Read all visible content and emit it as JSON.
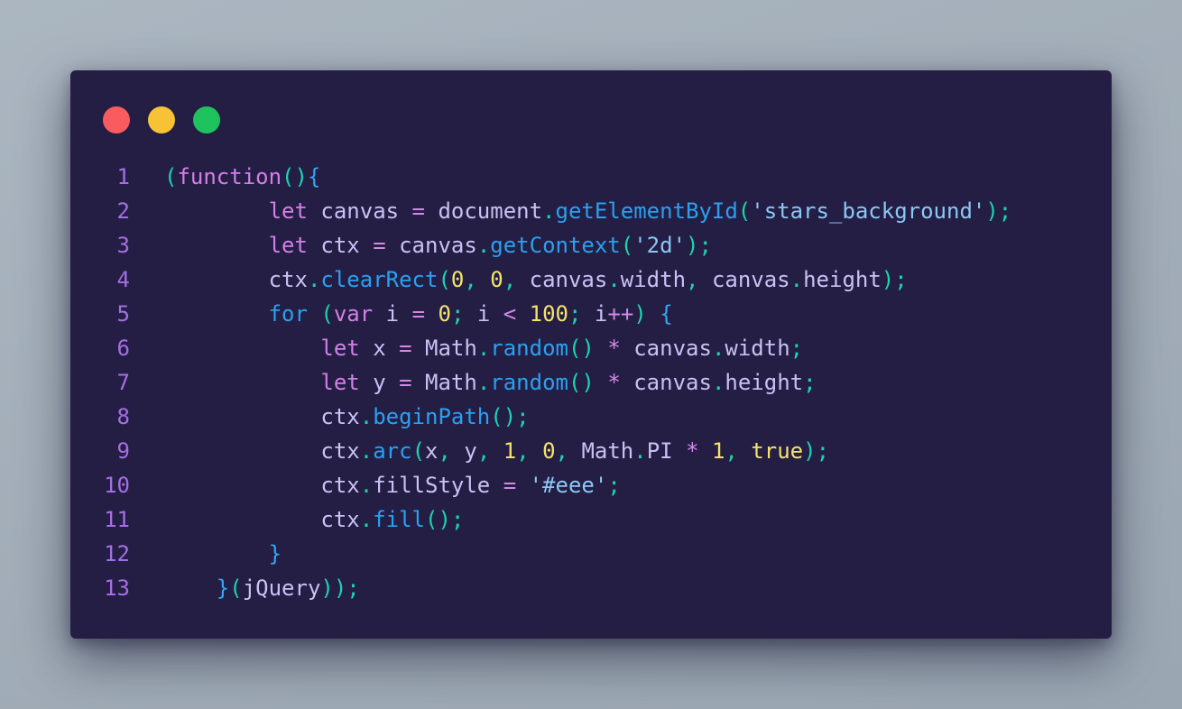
{
  "window": {
    "controls": [
      {
        "name": "close",
        "color": "#fa5b5e"
      },
      {
        "name": "minimize",
        "color": "#f7c235"
      },
      {
        "name": "maximize",
        "color": "#1ec35e"
      }
    ]
  },
  "code": {
    "language": "javascript",
    "lines": [
      {
        "number": "1",
        "indent": 0,
        "tokens": [
          {
            "t": "(",
            "c": "pn"
          },
          {
            "t": "function",
            "c": "kw"
          },
          {
            "t": "()",
            "c": "pn"
          },
          {
            "t": "{",
            "c": "br"
          }
        ]
      },
      {
        "number": "2",
        "indent": 8,
        "tokens": [
          {
            "t": "let",
            "c": "kw"
          },
          {
            "t": " canvas ",
            "c": "id"
          },
          {
            "t": "=",
            "c": "op"
          },
          {
            "t": " document",
            "c": "id"
          },
          {
            "t": ".",
            "c": "pn"
          },
          {
            "t": "getElementById",
            "c": "fn"
          },
          {
            "t": "(",
            "c": "pn"
          },
          {
            "t": "'stars_background'",
            "c": "str"
          },
          {
            "t": ");",
            "c": "pn"
          }
        ]
      },
      {
        "number": "3",
        "indent": 8,
        "tokens": [
          {
            "t": "let",
            "c": "kw"
          },
          {
            "t": " ctx ",
            "c": "id"
          },
          {
            "t": "=",
            "c": "op"
          },
          {
            "t": " canvas",
            "c": "id"
          },
          {
            "t": ".",
            "c": "pn"
          },
          {
            "t": "getContext",
            "c": "fn"
          },
          {
            "t": "(",
            "c": "pn"
          },
          {
            "t": "'2d'",
            "c": "str"
          },
          {
            "t": ");",
            "c": "pn"
          }
        ]
      },
      {
        "number": "4",
        "indent": 8,
        "tokens": [
          {
            "t": "ctx",
            "c": "id"
          },
          {
            "t": ".",
            "c": "pn"
          },
          {
            "t": "clearRect",
            "c": "fn"
          },
          {
            "t": "(",
            "c": "pn"
          },
          {
            "t": "0",
            "c": "num"
          },
          {
            "t": ", ",
            "c": "pn"
          },
          {
            "t": "0",
            "c": "num"
          },
          {
            "t": ", ",
            "c": "pn"
          },
          {
            "t": "canvas",
            "c": "id"
          },
          {
            "t": ".",
            "c": "pn"
          },
          {
            "t": "width",
            "c": "id"
          },
          {
            "t": ", ",
            "c": "pn"
          },
          {
            "t": "canvas",
            "c": "id"
          },
          {
            "t": ".",
            "c": "pn"
          },
          {
            "t": "height",
            "c": "id"
          },
          {
            "t": ");",
            "c": "pn"
          }
        ]
      },
      {
        "number": "5",
        "indent": 8,
        "tokens": [
          {
            "t": "for",
            "c": "fn"
          },
          {
            "t": " ",
            "c": "id"
          },
          {
            "t": "(",
            "c": "pn"
          },
          {
            "t": "var",
            "c": "kw"
          },
          {
            "t": " i ",
            "c": "id"
          },
          {
            "t": "=",
            "c": "op"
          },
          {
            "t": " ",
            "c": "id"
          },
          {
            "t": "0",
            "c": "num"
          },
          {
            "t": "; ",
            "c": "pn"
          },
          {
            "t": "i ",
            "c": "id"
          },
          {
            "t": "<",
            "c": "op"
          },
          {
            "t": " ",
            "c": "id"
          },
          {
            "t": "100",
            "c": "num"
          },
          {
            "t": "; ",
            "c": "pn"
          },
          {
            "t": "i",
            "c": "id"
          },
          {
            "t": "++",
            "c": "op"
          },
          {
            "t": ") ",
            "c": "pn"
          },
          {
            "t": "{",
            "c": "br"
          }
        ]
      },
      {
        "number": "6",
        "indent": 12,
        "tokens": [
          {
            "t": "let",
            "c": "kw"
          },
          {
            "t": " x ",
            "c": "id"
          },
          {
            "t": "=",
            "c": "op"
          },
          {
            "t": " Math",
            "c": "id"
          },
          {
            "t": ".",
            "c": "pn"
          },
          {
            "t": "random",
            "c": "fn"
          },
          {
            "t": "()",
            "c": "pn"
          },
          {
            "t": " ",
            "c": "id"
          },
          {
            "t": "*",
            "c": "op"
          },
          {
            "t": " canvas",
            "c": "id"
          },
          {
            "t": ".",
            "c": "pn"
          },
          {
            "t": "width",
            "c": "id"
          },
          {
            "t": ";",
            "c": "pn"
          }
        ]
      },
      {
        "number": "7",
        "indent": 12,
        "tokens": [
          {
            "t": "let",
            "c": "kw"
          },
          {
            "t": " y ",
            "c": "id"
          },
          {
            "t": "=",
            "c": "op"
          },
          {
            "t": " Math",
            "c": "id"
          },
          {
            "t": ".",
            "c": "pn"
          },
          {
            "t": "random",
            "c": "fn"
          },
          {
            "t": "()",
            "c": "pn"
          },
          {
            "t": " ",
            "c": "id"
          },
          {
            "t": "*",
            "c": "op"
          },
          {
            "t": " canvas",
            "c": "id"
          },
          {
            "t": ".",
            "c": "pn"
          },
          {
            "t": "height",
            "c": "id"
          },
          {
            "t": ";",
            "c": "pn"
          }
        ]
      },
      {
        "number": "8",
        "indent": 12,
        "tokens": [
          {
            "t": "ctx",
            "c": "id"
          },
          {
            "t": ".",
            "c": "pn"
          },
          {
            "t": "beginPath",
            "c": "fn"
          },
          {
            "t": "();",
            "c": "pn"
          }
        ]
      },
      {
        "number": "9",
        "indent": 12,
        "tokens": [
          {
            "t": "ctx",
            "c": "id"
          },
          {
            "t": ".",
            "c": "pn"
          },
          {
            "t": "arc",
            "c": "fn"
          },
          {
            "t": "(",
            "c": "pn"
          },
          {
            "t": "x",
            "c": "id"
          },
          {
            "t": ", ",
            "c": "pn"
          },
          {
            "t": "y",
            "c": "id"
          },
          {
            "t": ", ",
            "c": "pn"
          },
          {
            "t": "1",
            "c": "num"
          },
          {
            "t": ", ",
            "c": "pn"
          },
          {
            "t": "0",
            "c": "num"
          },
          {
            "t": ", ",
            "c": "pn"
          },
          {
            "t": "Math",
            "c": "id"
          },
          {
            "t": ".",
            "c": "pn"
          },
          {
            "t": "PI ",
            "c": "id"
          },
          {
            "t": "*",
            "c": "op"
          },
          {
            "t": " ",
            "c": "id"
          },
          {
            "t": "1",
            "c": "num"
          },
          {
            "t": ", ",
            "c": "pn"
          },
          {
            "t": "true",
            "c": "num"
          },
          {
            "t": ");",
            "c": "pn"
          }
        ]
      },
      {
        "number": "10",
        "indent": 12,
        "tokens": [
          {
            "t": "ctx",
            "c": "id"
          },
          {
            "t": ".",
            "c": "pn"
          },
          {
            "t": "fillStyle ",
            "c": "id"
          },
          {
            "t": "=",
            "c": "op"
          },
          {
            "t": " ",
            "c": "id"
          },
          {
            "t": "'#eee'",
            "c": "str"
          },
          {
            "t": ";",
            "c": "pn"
          }
        ]
      },
      {
        "number": "11",
        "indent": 12,
        "tokens": [
          {
            "t": "ctx",
            "c": "id"
          },
          {
            "t": ".",
            "c": "pn"
          },
          {
            "t": "fill",
            "c": "fn"
          },
          {
            "t": "();",
            "c": "pn"
          }
        ]
      },
      {
        "number": "12",
        "indent": 8,
        "tokens": [
          {
            "t": "}",
            "c": "br"
          }
        ]
      },
      {
        "number": "13",
        "indent": 4,
        "tokens": [
          {
            "t": "}",
            "c": "br"
          },
          {
            "t": "(",
            "c": "pn"
          },
          {
            "t": "jQuery",
            "c": "id"
          },
          {
            "t": "));",
            "c": "pn"
          }
        ]
      }
    ]
  }
}
